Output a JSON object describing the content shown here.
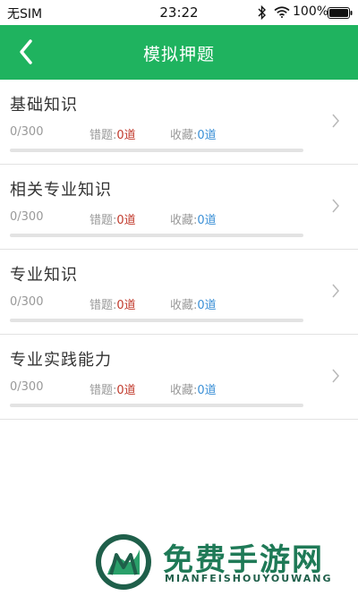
{
  "status_bar": {
    "carrier": "无SIM",
    "time": "23:22",
    "battery": "100%",
    "icons": [
      "bluetooth-icon",
      "wifi-icon",
      "battery-icon"
    ]
  },
  "nav": {
    "title": "模拟押题",
    "back_icon": "chevron-left-icon"
  },
  "colors": {
    "accent": "#1fb35f",
    "wrong_count": "#c0392b",
    "fav_count": "#3a8fd6"
  },
  "items": [
    {
      "title": "基础知识",
      "progress": "0/300",
      "progress_fraction": 0,
      "wrong_label": "错题:",
      "wrong_count": "0道",
      "fav_label": "收藏:",
      "fav_count": "0道"
    },
    {
      "title": "相关专业知识",
      "progress": "0/300",
      "progress_fraction": 0,
      "wrong_label": "错题:",
      "wrong_count": "0道",
      "fav_label": "收藏:",
      "fav_count": "0道"
    },
    {
      "title": "专业知识",
      "progress": "0/300",
      "progress_fraction": 0,
      "wrong_label": "错题:",
      "wrong_count": "0道",
      "fav_label": "收藏:",
      "fav_count": "0道"
    },
    {
      "title": "专业实践能力",
      "progress": "0/300",
      "progress_fraction": 0,
      "wrong_label": "错题:",
      "wrong_count": "0道",
      "fav_label": "收藏:",
      "fav_count": "0道"
    }
  ],
  "watermark": {
    "name": "免费手游网",
    "subtitle": "MIANFEISHOUYOUWANG"
  }
}
